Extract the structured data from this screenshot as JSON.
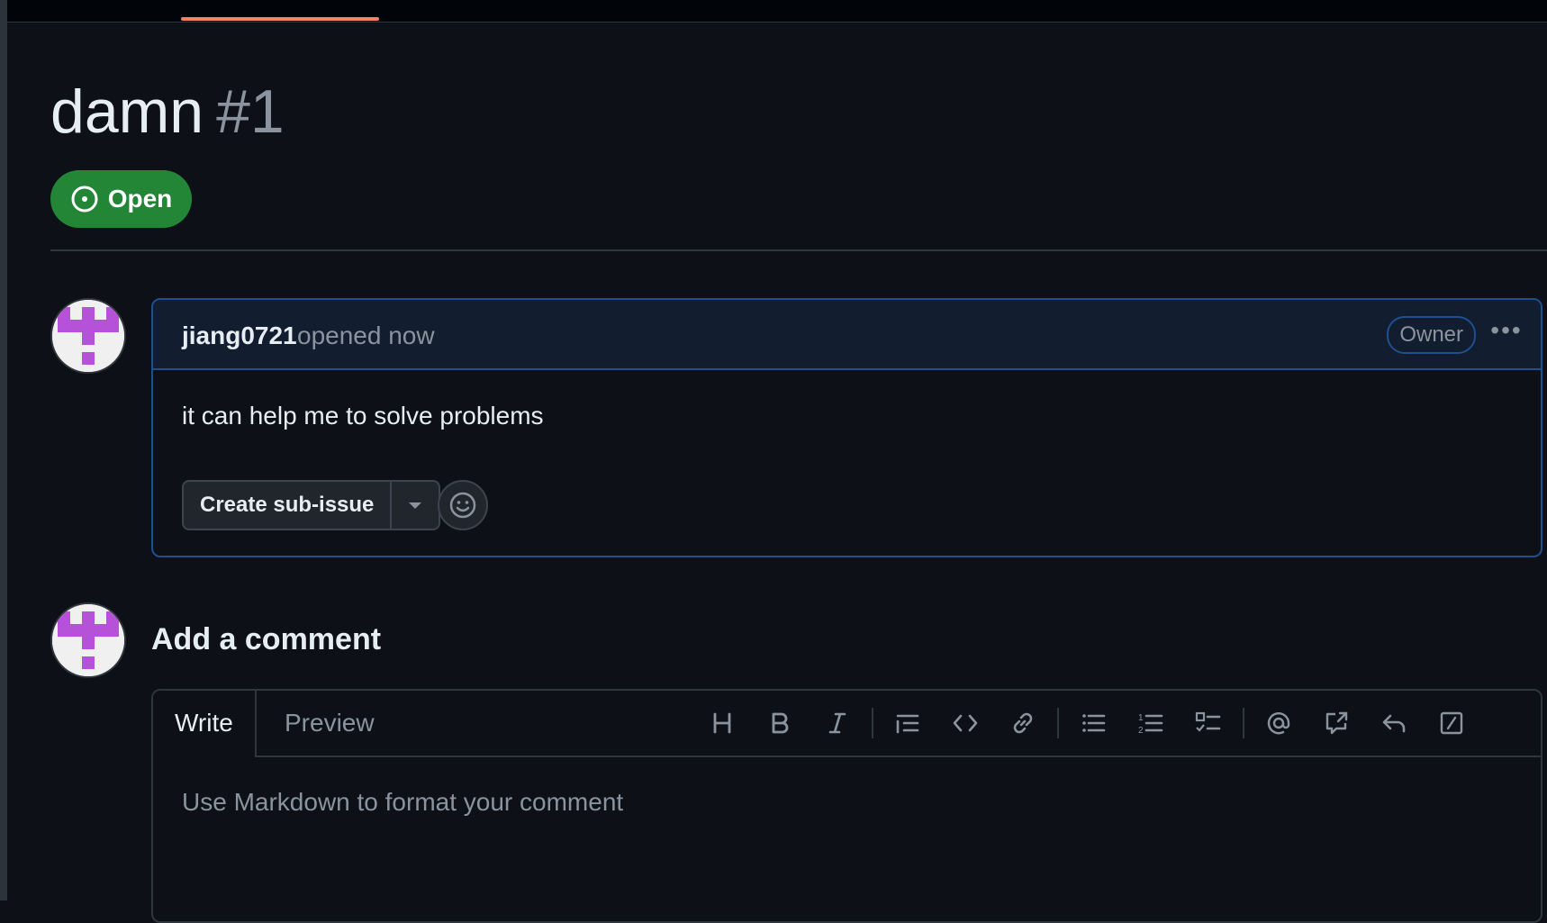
{
  "issue": {
    "title": "damn",
    "number": "#1",
    "status": "Open"
  },
  "comment": {
    "author": "jiang0721",
    "meta": "opened now",
    "role_badge": "Owner",
    "body": "it can help me to solve problems",
    "create_subissue_label": "Create sub-issue"
  },
  "new_comment": {
    "heading": "Add a comment",
    "tabs": {
      "write": "Write",
      "preview": "Preview"
    },
    "placeholder": "Use Markdown to format your comment"
  },
  "colors": {
    "background": "#0d1117",
    "accent_open": "#238636",
    "tab_underline": "#f78166",
    "border_blue": "#1f4f8f",
    "avatar_purple": "#b651d9"
  }
}
